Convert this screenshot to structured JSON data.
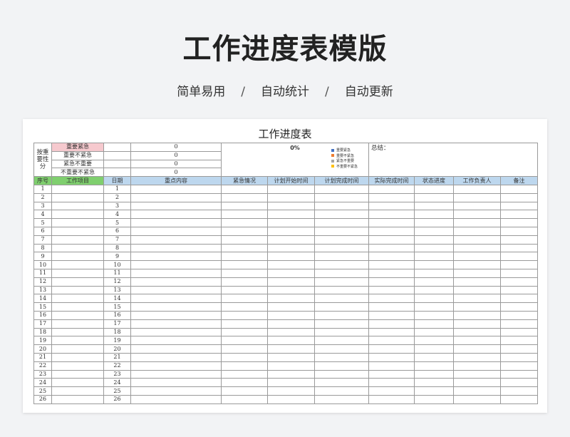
{
  "banner": {
    "title": "工作进度表模版",
    "subtitle": [
      "简单易用",
      "自动统计",
      "自动更新"
    ],
    "separator": "/"
  },
  "sheet": {
    "title": "工作进度表",
    "classify_label": "按重要性分",
    "categories": [
      {
        "label": "重要紧急",
        "count": "0"
      },
      {
        "label": "重要不紧急",
        "count": "0"
      },
      {
        "label": "紧急不重要",
        "count": "0"
      },
      {
        "label": "不重要不紧急",
        "count": "0"
      }
    ],
    "percent": "0%",
    "legend": [
      {
        "label": "重要紧急",
        "color": "#4472c4"
      },
      {
        "label": "重要不紧急",
        "color": "#ed7d31"
      },
      {
        "label": "紧急不重要",
        "color": "#a5a5a5"
      },
      {
        "label": "不重要不紧急",
        "color": "#ffc000"
      }
    ],
    "summary_label": "总结：",
    "headers": [
      "序号",
      "工作项目",
      "日期",
      "重点内容",
      "紧急情况",
      "计划开始时间",
      "计划完成时间",
      "实际完成时间",
      "状态进度",
      "工作负责人",
      "备注"
    ],
    "rows": [
      "1",
      "2",
      "3",
      "4",
      "5",
      "6",
      "7",
      "8",
      "9",
      "10",
      "11",
      "12",
      "13",
      "14",
      "15",
      "16",
      "17",
      "18",
      "19",
      "20",
      "21",
      "22",
      "23",
      "24",
      "25",
      "26"
    ]
  }
}
